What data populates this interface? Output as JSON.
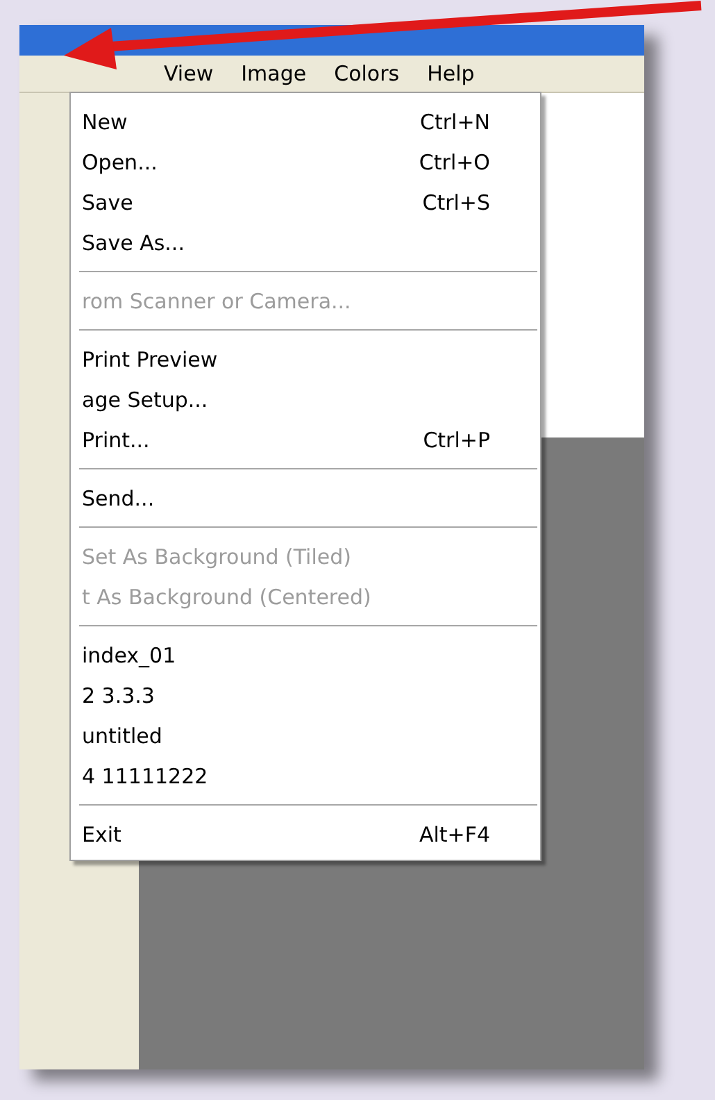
{
  "menu_bar": {
    "items": [
      {
        "label": "View",
        "selected": false
      },
      {
        "label": "Image",
        "selected": false
      },
      {
        "label": "Colors",
        "selected": false
      },
      {
        "label": "Help",
        "selected": false
      }
    ]
  },
  "file_menu": {
    "items": [
      {
        "kind": "item",
        "label": "New",
        "shortcut": "Ctrl+N",
        "disabled": false
      },
      {
        "kind": "item",
        "label": "Open...",
        "shortcut": "Ctrl+O",
        "disabled": false
      },
      {
        "kind": "item",
        "label": "Save",
        "shortcut": "Ctrl+S",
        "disabled": false
      },
      {
        "kind": "item",
        "label": "Save As...",
        "disabled": false
      },
      {
        "kind": "separator"
      },
      {
        "kind": "item",
        "label": "rom Scanner or Camera...",
        "disabled": true
      },
      {
        "kind": "separator"
      },
      {
        "kind": "item",
        "label": "Print Preview",
        "disabled": false
      },
      {
        "kind": "item",
        "label": "age Setup...",
        "disabled": false
      },
      {
        "kind": "item",
        "label": "Print...",
        "shortcut": "Ctrl+P",
        "disabled": false
      },
      {
        "kind": "separator"
      },
      {
        "kind": "item",
        "label": "Send...",
        "disabled": false
      },
      {
        "kind": "separator"
      },
      {
        "kind": "item",
        "label": "Set As Background (Tiled)",
        "disabled": true
      },
      {
        "kind": "item",
        "label": "t As Background (Centered)",
        "disabled": true
      },
      {
        "kind": "separator"
      },
      {
        "kind": "item",
        "label": "index_01",
        "disabled": false
      },
      {
        "kind": "item",
        "label": "2 3.3.3",
        "disabled": false
      },
      {
        "kind": "item",
        "label": "untitled",
        "disabled": false
      },
      {
        "kind": "item",
        "label": "4 11111222",
        "disabled": false
      },
      {
        "kind": "separator"
      },
      {
        "kind": "item",
        "label": "Exit",
        "shortcut": "Alt+F4",
        "disabled": false
      }
    ]
  }
}
